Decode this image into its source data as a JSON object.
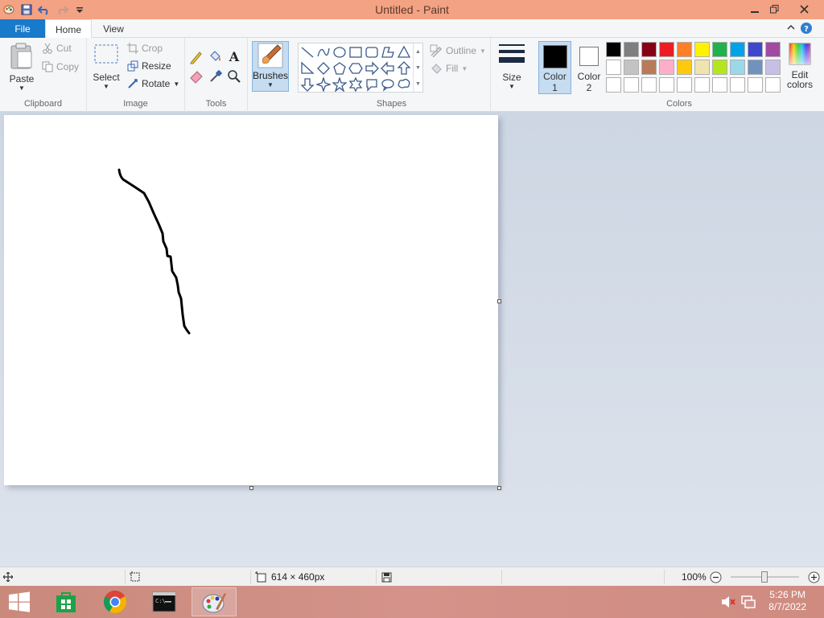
{
  "window": {
    "title": "Untitled - Paint",
    "controls": {
      "minimize": "minimize-icon",
      "restore": "restore-icon",
      "close": "close-icon"
    }
  },
  "tabs": {
    "file": "File",
    "home": "Home",
    "view": "View"
  },
  "ribbon": {
    "clipboard": {
      "paste": "Paste",
      "cut": "Cut",
      "copy": "Copy",
      "group": "Clipboard"
    },
    "image": {
      "select": "Select",
      "crop": "Crop",
      "resize": "Resize",
      "rotate": "Rotate",
      "group": "Image"
    },
    "tools": {
      "group": "Tools"
    },
    "brushes": {
      "label": "Brushes"
    },
    "shapes": {
      "outline": "Outline",
      "fill": "Fill",
      "group": "Shapes"
    },
    "size": {
      "label": "Size"
    },
    "colors": {
      "color1_label": "Color",
      "color1_num": "1",
      "color2_label": "Color",
      "color2_num": "2",
      "edit_label": "Edit",
      "edit_label2": "colors",
      "group": "Colors",
      "color1": "#000000",
      "color2": "#ffffff",
      "palette": [
        [
          "#000000",
          "#7f7f7f",
          "#880015",
          "#ed1c24",
          "#ff7f27",
          "#fff200",
          "#22b14c",
          "#00a2e8",
          "#3f48cc",
          "#a349a4"
        ],
        [
          "#ffffff",
          "#c3c3c3",
          "#b97a57",
          "#ffaec9",
          "#ffc90e",
          "#efe4b0",
          "#b5e61d",
          "#99d9ea",
          "#7092be",
          "#c8bfe7"
        ],
        [
          "#ffffff",
          "#ffffff",
          "#ffffff",
          "#ffffff",
          "#ffffff",
          "#ffffff",
          "#ffffff",
          "#ffffff",
          "#ffffff",
          "#ffffff"
        ]
      ]
    }
  },
  "status": {
    "canvas_size": "614 × 460px",
    "zoom": "100%"
  },
  "taskbar": {
    "time": "5:26 PM",
    "date": "8/7/2022"
  }
}
